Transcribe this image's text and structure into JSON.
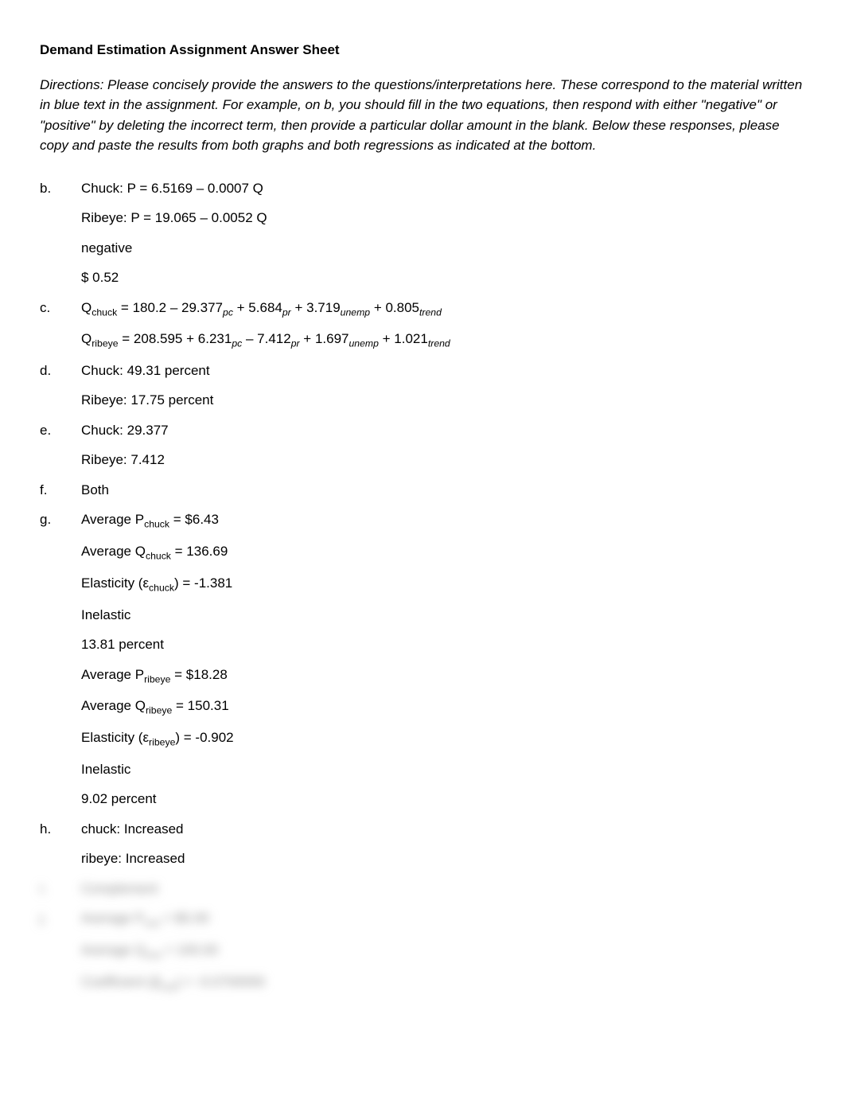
{
  "title": "Demand Estimation Assignment Answer Sheet",
  "directions": "Directions: Please concisely provide the answers to the questions/interpretations here. These correspond to the material written in blue text in the assignment. For example, on b, you should fill in the two equations, then respond with either \"negative\" or \"positive\" by deleting the incorrect term, then provide a particular dollar amount in the blank. Below these responses, please copy and paste the results from both graphs and both regressions as indicated at the bottom.",
  "items": {
    "b": {
      "label": "b.",
      "chuck": "Chuck: P = 6.5169 – 0.0007 Q",
      "ribeye": "Ribeye: P = 19.065 – 0.0052 Q",
      "sign": "negative",
      "amount": "$ 0.52"
    },
    "c": {
      "label": "c.",
      "chuck": {
        "prefix": "Q",
        "sub1": "chuck",
        "eq": " = 180.2 – 29.377",
        "s_pc": "pc",
        "t2": " + 5.684",
        "s_pr": "pr",
        "t3": " + 3.719",
        "s_unemp": "unemp",
        "t4": " + 0.805",
        "s_trend": "trend"
      },
      "ribeye": {
        "prefix": "Q",
        "sub1": "ribeye",
        "eq": " = 208.595 + 6.231",
        "s_pc": "pc",
        "t2": " – 7.412",
        "s_pr": "pr",
        "t3": " + 1.697",
        "s_unemp": "unemp",
        "t4": " + 1.021",
        "s_trend": "trend"
      }
    },
    "d": {
      "label": "d.",
      "chuck": "Chuck: 49.31 percent",
      "ribeye": "Ribeye: 17.75 percent"
    },
    "e": {
      "label": "e.",
      "chuck": "Chuck: 29.377",
      "ribeye": "Ribeye: 7.412"
    },
    "f": {
      "label": "f.",
      "value": "Both"
    },
    "g": {
      "label": "g.",
      "l1a": "Average P",
      "l1s": "chuck",
      "l1b": " = $6.43",
      "l2a": "Average Q",
      "l2s": "chuck",
      "l2b": " = 136.69",
      "l3a": "Elasticity (ε",
      "l3s": "chuck",
      "l3b": ") = -1.381",
      "l4": "Inelastic",
      "l5": "13.81 percent",
      "l6a": "Average P",
      "l6s": "ribeye",
      "l6b": " = $18.28",
      "l7a": "Average Q",
      "l7s": "ribeye",
      "l7b": " = 150.31",
      "l8a": "Elasticity (ε",
      "l8s": "ribeye",
      "l8b": ") = -0.902",
      "l9": "Inelastic",
      "l10": "9.02 percent"
    },
    "h": {
      "label": "h.",
      "chuck": "chuck: Increased",
      "ribeye": "ribeye: Increased"
    },
    "i": {
      "label": "i.",
      "value": "Complement"
    },
    "j": {
      "label": "j.",
      "l1a": "Average P",
      "l1s": "sub",
      "l1b": " = $5.00",
      "l2a": "Average Q",
      "l2s": "sub",
      "l2b": " = 100.00",
      "l3a": "Coefficient (β",
      "l3s": "sub",
      "l3b": ") = -0.0700000"
    }
  }
}
